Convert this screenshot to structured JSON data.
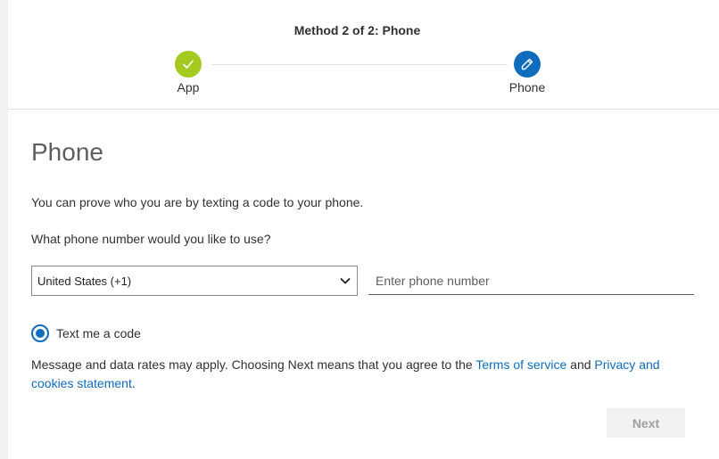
{
  "stepper": {
    "title": "Method 2 of 2: Phone",
    "steps": [
      {
        "label": "App",
        "state": "complete",
        "icon": "checkmark-icon",
        "color": "#a4c91f"
      },
      {
        "label": "Phone",
        "state": "current",
        "icon": "pencil-icon",
        "color": "#0f6cbd"
      }
    ]
  },
  "main": {
    "section_title": "Phone",
    "description": "You can prove who you are by texting a code to your phone.",
    "question": "What phone number would you like to use?",
    "country_select": {
      "selected": "United States (+1)",
      "icon": "chevron-down-icon"
    },
    "phone_input": {
      "value": "",
      "placeholder": "Enter phone number"
    },
    "method_option": {
      "label": "Text me a code",
      "checked": true
    },
    "legal": {
      "text_before": "Message and data rates may apply. Choosing Next means that you agree to the ",
      "terms_link": "Terms of service",
      "text_and": " and ",
      "privacy_link": "Privacy and cookies statement",
      "text_after": "."
    },
    "next_button": {
      "label": "Next",
      "enabled": false
    }
  },
  "colors": {
    "accent": "#0f6cbd",
    "complete": "#a4c91f",
    "link": "#0f6cbd",
    "disabled_bg": "#f3f2f1",
    "disabled_text": "#a19f9d"
  }
}
